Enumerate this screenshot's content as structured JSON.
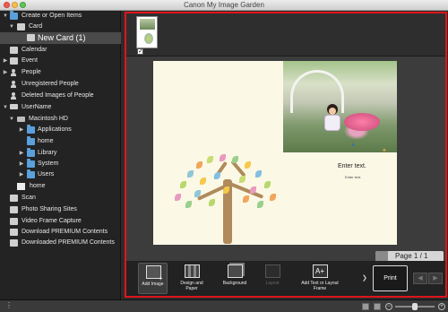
{
  "window": {
    "title": "Canon My Image Garden"
  },
  "sidebar": {
    "items": [
      {
        "label": "Create or Open Items",
        "icon": "folder-icon"
      },
      {
        "label": "Card",
        "icon": "card-icon"
      },
      {
        "label": "New Card (1)",
        "icon": "card-icon",
        "selected": true
      },
      {
        "label": "Calendar",
        "icon": "calendar-icon"
      },
      {
        "label": "Event",
        "icon": "event-icon"
      },
      {
        "label": "People",
        "icon": "person-icon"
      },
      {
        "label": "Unregistered People",
        "icon": "person-icon"
      },
      {
        "label": "Deleted Images of People",
        "icon": "person-icon"
      },
      {
        "label": "UserName",
        "icon": "computer-icon"
      },
      {
        "label": "Macintosh HD",
        "icon": "disk-icon"
      },
      {
        "label": "Applications",
        "icon": "folder-icon"
      },
      {
        "label": "home",
        "icon": "folder-icon"
      },
      {
        "label": "Library",
        "icon": "folder-icon"
      },
      {
        "label": "System",
        "icon": "folder-icon"
      },
      {
        "label": "Users",
        "icon": "folder-icon"
      },
      {
        "label": "home",
        "icon": "home-icon"
      },
      {
        "label": "Scan",
        "icon": "scan-icon"
      },
      {
        "label": "Photo Sharing Sites",
        "icon": "photo-sharing-icon"
      },
      {
        "label": "Video Frame Capture",
        "icon": "video-icon"
      },
      {
        "label": "Download PREMIUM Contents",
        "icon": "download-icon"
      },
      {
        "label": "Downloaded PREMIUM Contents",
        "icon": "downloaded-icon"
      }
    ]
  },
  "editor": {
    "page_text": "Enter text.",
    "page_subtext": "Enter text.",
    "page_indicator": "Page 1 / 1"
  },
  "toolbar": {
    "add_image": "Add Image",
    "design_and_paper": "Design and Paper",
    "background": "Background",
    "layout": "Layout",
    "add_text": "Add Text or Layout Frame",
    "print": "Print",
    "prev": "◀",
    "next": "▶"
  },
  "colors": {
    "highlight_border": "#e0141b",
    "selected_item_bg": "#4a4a4a"
  }
}
